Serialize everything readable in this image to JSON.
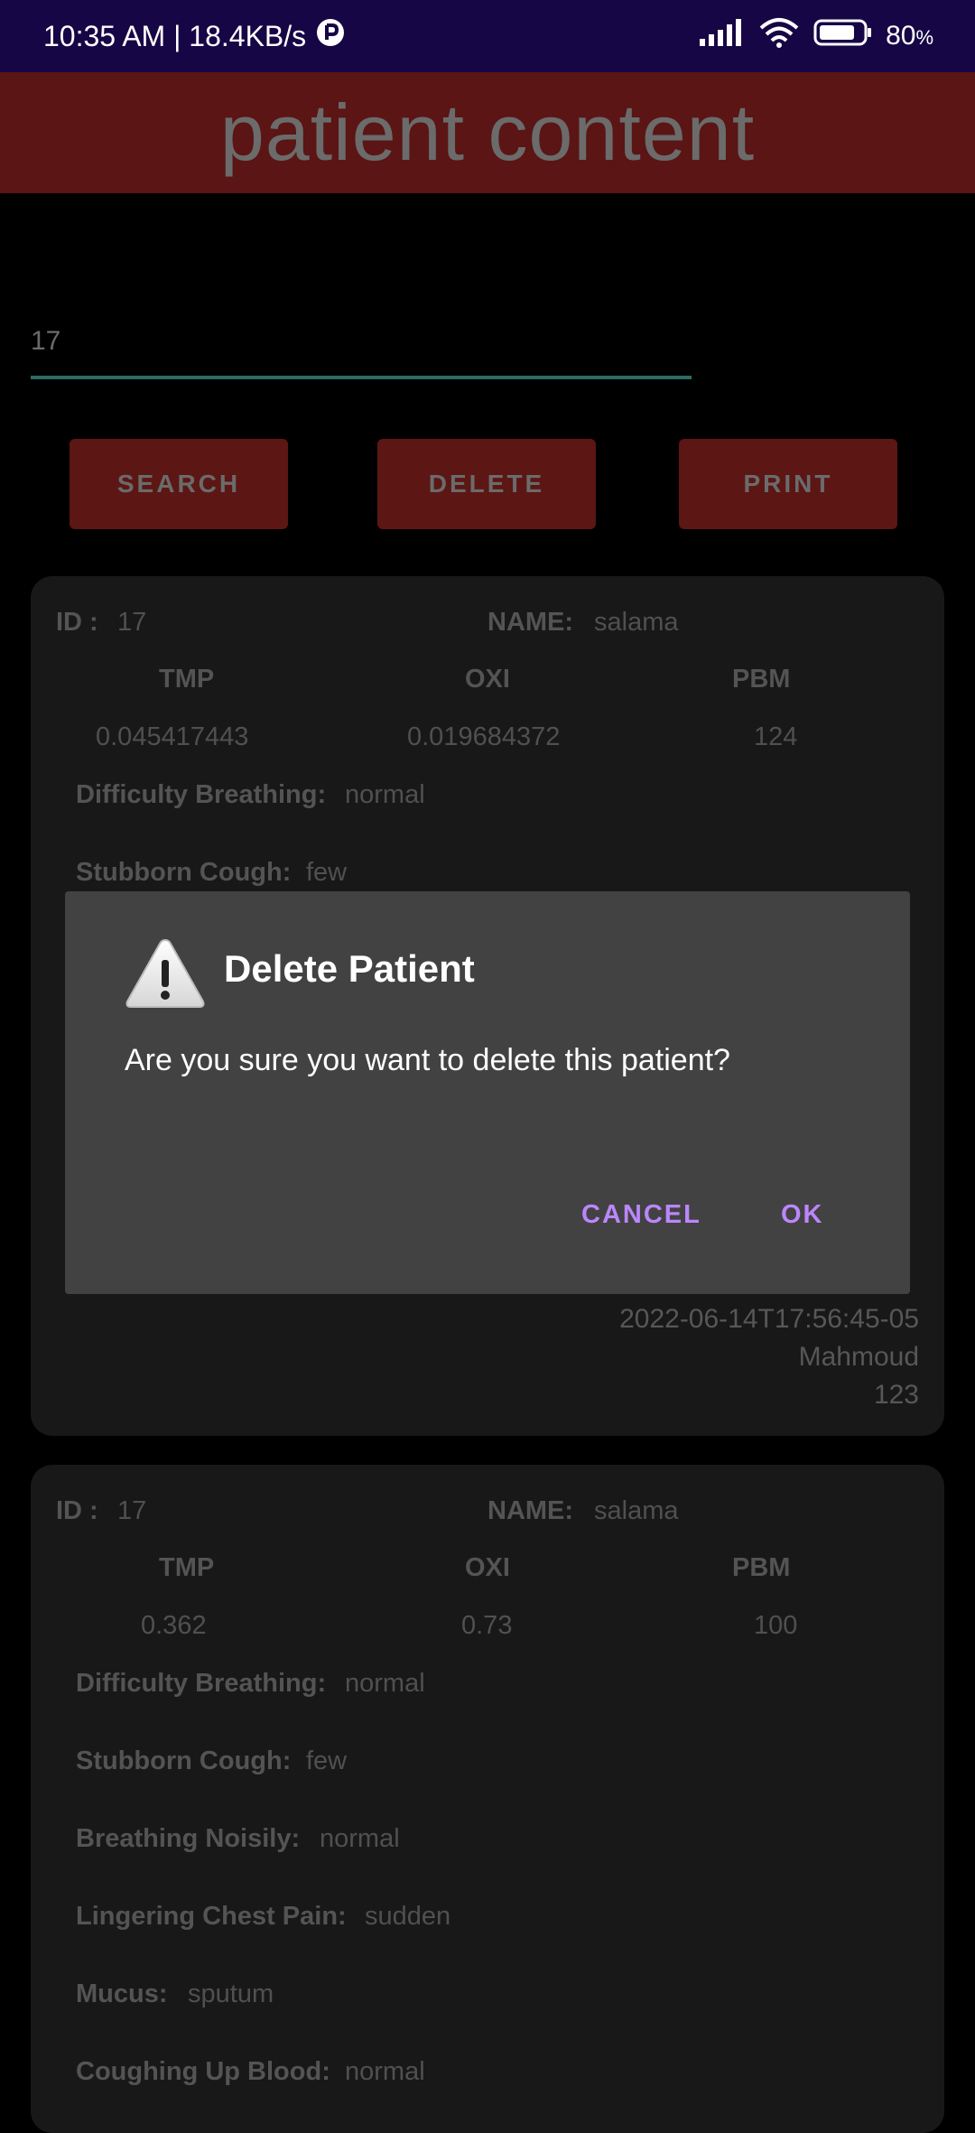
{
  "status_bar": {
    "time_speed": "10:35 AM | 18.4KB/s",
    "battery_percent": "80",
    "battery_unit": "%"
  },
  "header": {
    "title": "patient content"
  },
  "search": {
    "value": "17"
  },
  "buttons": {
    "search": "SEARCH",
    "delete": "DELETE",
    "print": "PRINT"
  },
  "cards": [
    {
      "id_label": "ID :",
      "id": "17",
      "name_label": "NAME:",
      "name": "salama",
      "tmp_label": "TMP",
      "oxi_label": "OXI",
      "pbm_label": "PBM",
      "tmp": "0.045417443",
      "oxi": "0.019684372",
      "pbm": "124",
      "difficulty_label": "Difficulty Breathing:",
      "difficulty": "normal",
      "cough_label": "Stubborn Cough:",
      "cough": "few",
      "date": "2022-06-14T17:56:45-05",
      "doctor": "Mahmoud",
      "number": "123"
    },
    {
      "id_label": "ID :",
      "id": "17",
      "name_label": "NAME:",
      "name": "salama",
      "tmp_label": "TMP",
      "oxi_label": "OXI",
      "pbm_label": "PBM",
      "tmp": "0.362",
      "oxi": "0.73",
      "pbm": "100",
      "difficulty_label": "Difficulty Breathing:",
      "difficulty": "normal",
      "cough_label": "Stubborn Cough:",
      "cough": "few",
      "noisily_label": "Breathing Noisily:",
      "noisily": "normal",
      "chest_label": "Lingering Chest Pain:",
      "chest": "sudden",
      "mucus_label": "Mucus:",
      "mucus": "sputum",
      "blood_label": "Coughing Up Blood:",
      "blood": "normal"
    }
  ],
  "dialog": {
    "icon": "warning-icon",
    "title": "Delete Patient",
    "message": "Are you sure you want to delete this patient?",
    "cancel": "CANCEL",
    "ok": "OK"
  },
  "colors": {
    "status_bar": "#170645",
    "header": "#5a1514",
    "button": "#5c1614",
    "dialog": "#424242",
    "dialog_button": "#bb86fc",
    "field_underline": "#2f6a62"
  }
}
